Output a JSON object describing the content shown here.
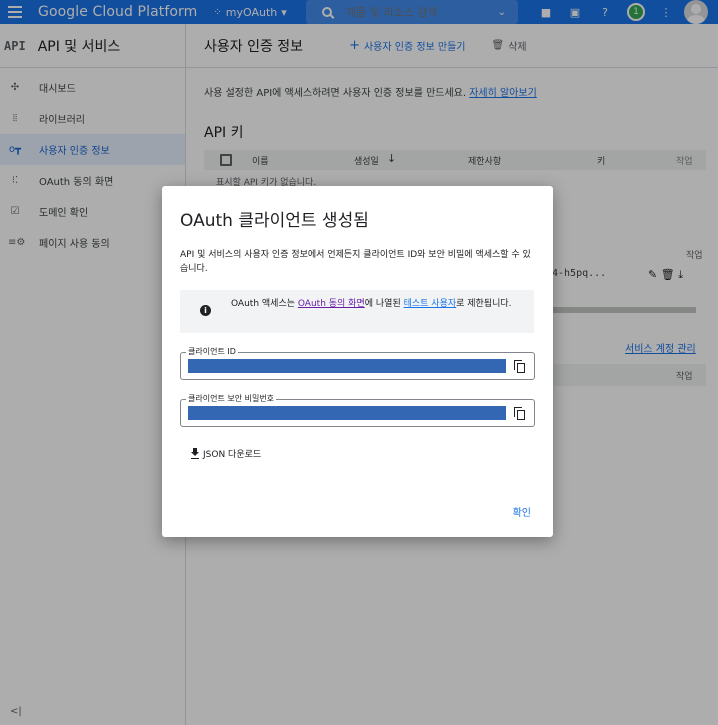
{
  "topbar": {
    "brand": "Google Cloud Platform",
    "project": "myOAuth",
    "search_placeholder": "제품 및 리소스 검색",
    "notification_count": "1"
  },
  "sidebar": {
    "logo": "API",
    "title": "API 및 서비스",
    "items": [
      {
        "label": "대시보드",
        "icon": "dashboard-icon"
      },
      {
        "label": "라이브러리",
        "icon": "library-icon"
      },
      {
        "label": "사용자 인증 정보",
        "icon": "key-icon",
        "active": true
      },
      {
        "label": "OAuth 동의 화면",
        "icon": "consent-icon"
      },
      {
        "label": "도메인 확인",
        "icon": "domain-icon"
      },
      {
        "label": "페이지 사용 동의",
        "icon": "settings-icon"
      }
    ],
    "collapse_label": "<|"
  },
  "main": {
    "title": "사용자 인증 정보",
    "create_label": "사용자 인증 정보 만들기",
    "delete_label": "삭제",
    "intro_text": "사용 설정한 API에 액세스하려면 사용자 인증 정보를 만드세요. ",
    "intro_link": "자세히 알아보기",
    "api_keys_title": "API 키",
    "table_headers": {
      "name": "이름",
      "created": "생성일",
      "restrictions": "제한사항",
      "key": "키",
      "actions": "작업"
    },
    "empty_text": "표시할 API 키가 없습니다.",
    "bg_actions_header": "작업",
    "bg_client_id_partial": "4-h5pq...",
    "bg_service_link": "서비스 계정 관리",
    "bg_actions_header_2": "작업"
  },
  "dialog": {
    "title": "OAuth 클라이언트 생성됨",
    "description": "API 및 서비스의 사용자 인증 정보에서 언제든지 클라이언트 ID와 보안 비밀에 액세스할 수 있습니다.",
    "info_prefix": "OAuth 액세스는 ",
    "info_link1": "OAuth 동의 화면",
    "info_mid": "에 나열된 ",
    "info_link2": "테스트 사용자",
    "info_suffix": "로 제한됩니다.",
    "client_id_label": "클라이언트 ID",
    "client_secret_label": "클라이언트 보안 비밀번호",
    "json_download": "JSON 다운로드",
    "ok_label": "확인"
  }
}
